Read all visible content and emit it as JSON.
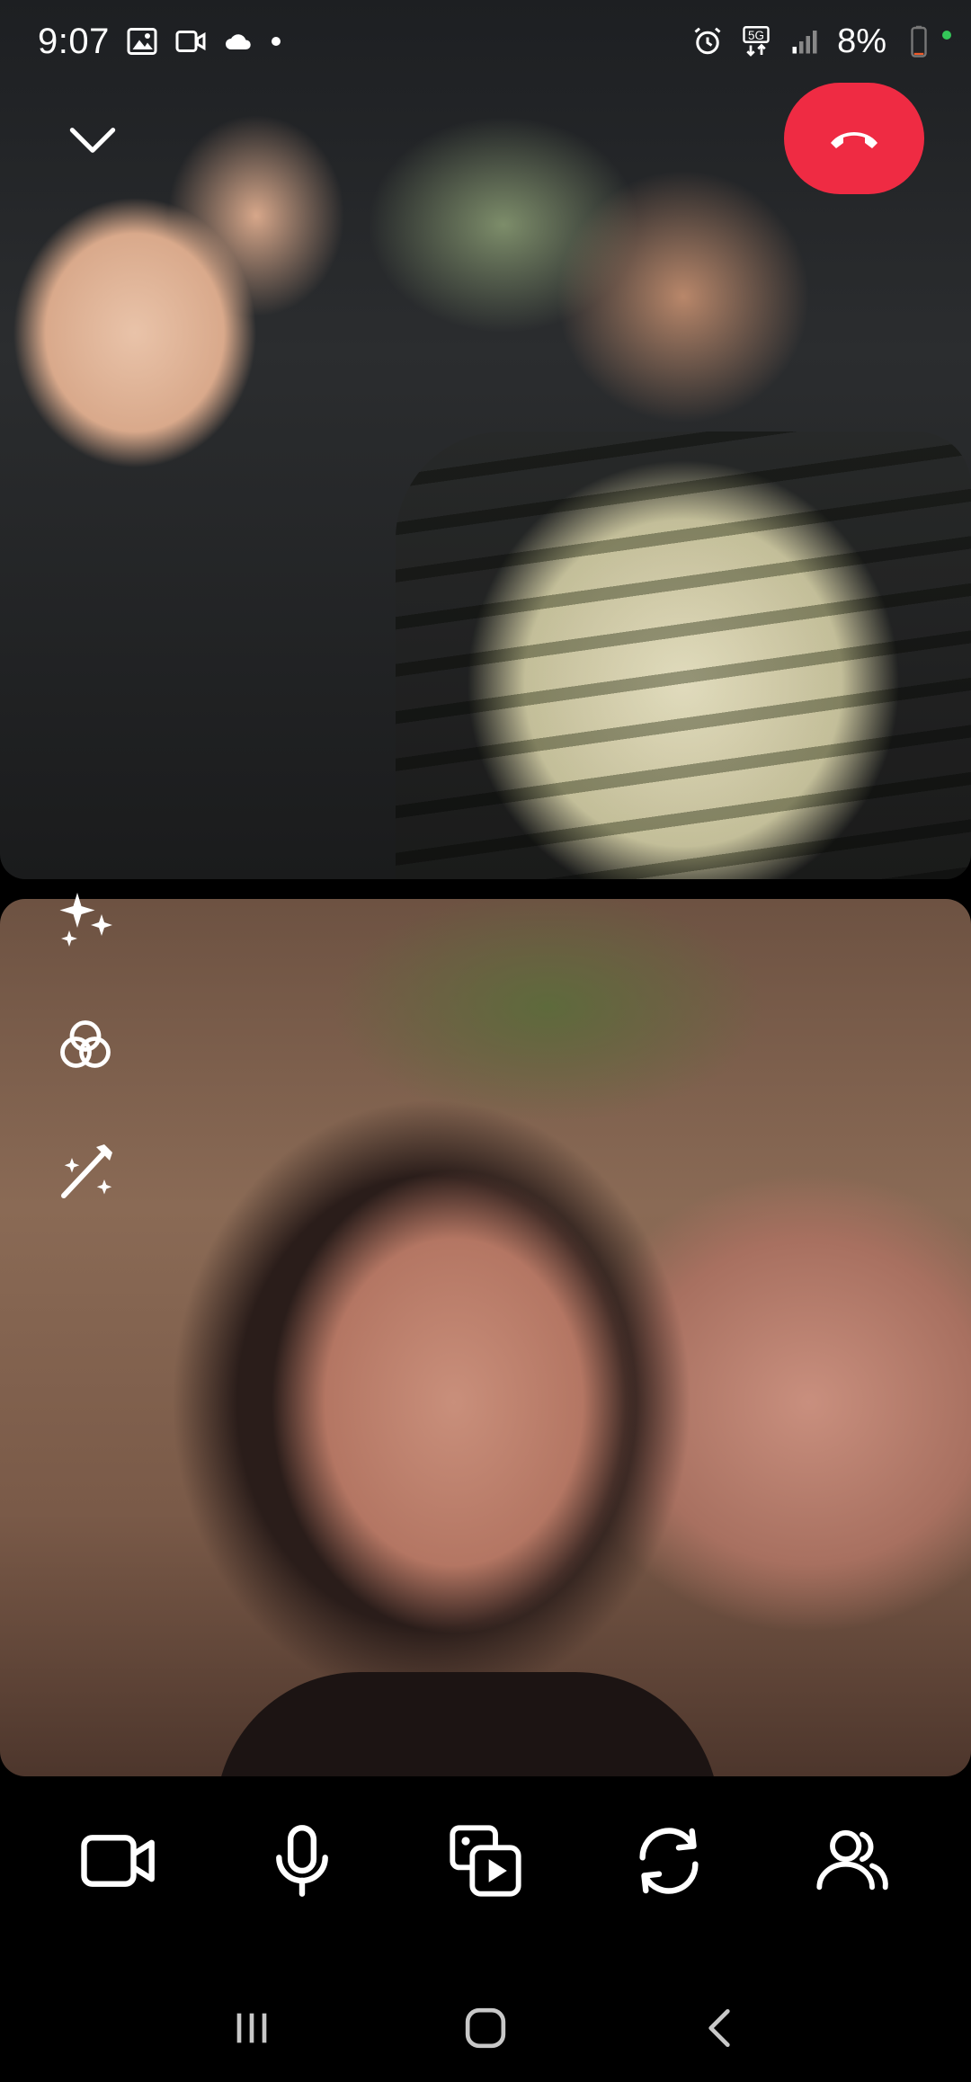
{
  "status_bar": {
    "time": "9:07",
    "network": "5G",
    "battery_percent": "8%",
    "battery_level": 0.08,
    "left_icons": [
      "gallery-icon",
      "video-recorder-icon",
      "cloud-icon",
      "dot-icon"
    ],
    "right_icons": [
      "alarm-icon",
      "5g-data-icon",
      "signal-icon",
      "battery-icon"
    ]
  },
  "call": {
    "remote_video": "remote-participants-video",
    "local_video": "self-view-video",
    "end_call_color": "#ef2b43"
  },
  "effects_toolbar": {
    "items": [
      {
        "name": "sparkles-icon"
      },
      {
        "name": "filters-icon"
      },
      {
        "name": "magic-wand-icon"
      }
    ]
  },
  "call_controls": {
    "items": [
      {
        "name": "camera-icon"
      },
      {
        "name": "microphone-icon"
      },
      {
        "name": "share-media-icon"
      },
      {
        "name": "flip-camera-icon"
      },
      {
        "name": "participants-icon"
      }
    ]
  },
  "nav_bar": {
    "items": [
      {
        "name": "recents-icon"
      },
      {
        "name": "home-icon"
      },
      {
        "name": "back-icon"
      }
    ]
  },
  "colors": {
    "background": "#000000",
    "end_call": "#ef2b43",
    "icon": "#ffffff"
  }
}
